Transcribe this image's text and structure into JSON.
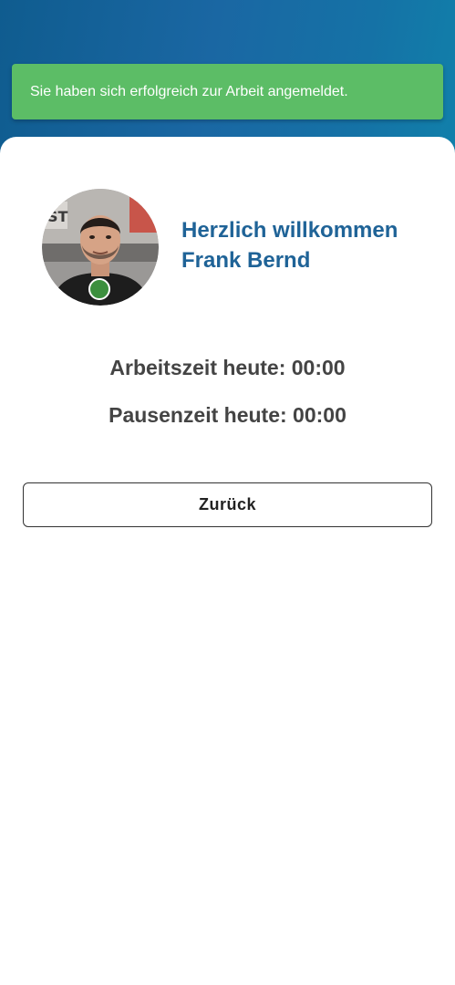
{
  "toast": {
    "message": "Sie haben sich erfolgreich zur Arbeit angemeldet."
  },
  "profile": {
    "welcome_line": "Herzlich willkommen",
    "user_name": "Frank Bernd",
    "status_color": "#3c8f3e"
  },
  "stats": {
    "work_time": "Arbeitszeit heute: 00:00",
    "pause_time": "Pausenzeit heute: 00:00"
  },
  "actions": {
    "back_label": "Zurück"
  },
  "colors": {
    "toast_bg": "#5cbd66",
    "accent": "#1f6397",
    "header_gradient_start": "#0f5c8f",
    "header_gradient_end": "#0b93b0"
  }
}
